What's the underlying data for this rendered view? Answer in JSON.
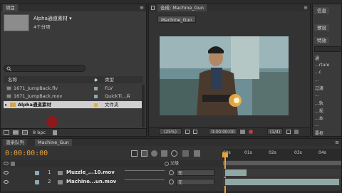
{
  "project_panel": {
    "tab": "项目",
    "menu_glyph": "≡",
    "item_name": "Alpha通道素材 ▾",
    "item_info": "4个分项",
    "columns": {
      "name": "名称",
      "type": "类型"
    },
    "files": [
      {
        "name": "1671_JumpBack.flv",
        "type": "FLV"
      },
      {
        "name": "1671_JumpBack.mov",
        "type": "QuickTi...片"
      },
      {
        "name": "Alpha通道素材",
        "type": "文件夹"
      }
    ],
    "bpc": "8 bpc"
  },
  "composition_panel": {
    "tab_label": "合成: Machine_Gun",
    "comp_tab": "Machine_Gun",
    "zoom": "(25%)",
    "timecode": "0:00:00:00",
    "resolution": "(1/4)"
  },
  "right_panel": {
    "tabs": [
      "信息",
      "预设",
      "特效"
    ],
    "items": [
      "通",
      "...rture",
      "...c",
      "...",
      "过渡",
      "...",
      "...轨",
      "...视",
      "...本",
      "...",
      "要抠"
    ]
  },
  "timeline": {
    "tabs": [
      "渲染队列",
      "Machine_Gun"
    ],
    "timecode": "0:00:00:00",
    "ruler": [
      "00s",
      "01s",
      "02s",
      "03s",
      "04s"
    ],
    "parent_header": "父级",
    "layers": [
      {
        "num": "1",
        "name": "Muzzle_...10.mov",
        "parent": "无"
      },
      {
        "num": "2",
        "name": "Machine...un.mov",
        "parent": "无"
      }
    ]
  },
  "colors": {
    "accent": "#e8a23a",
    "clip": "#8fa8a3"
  }
}
